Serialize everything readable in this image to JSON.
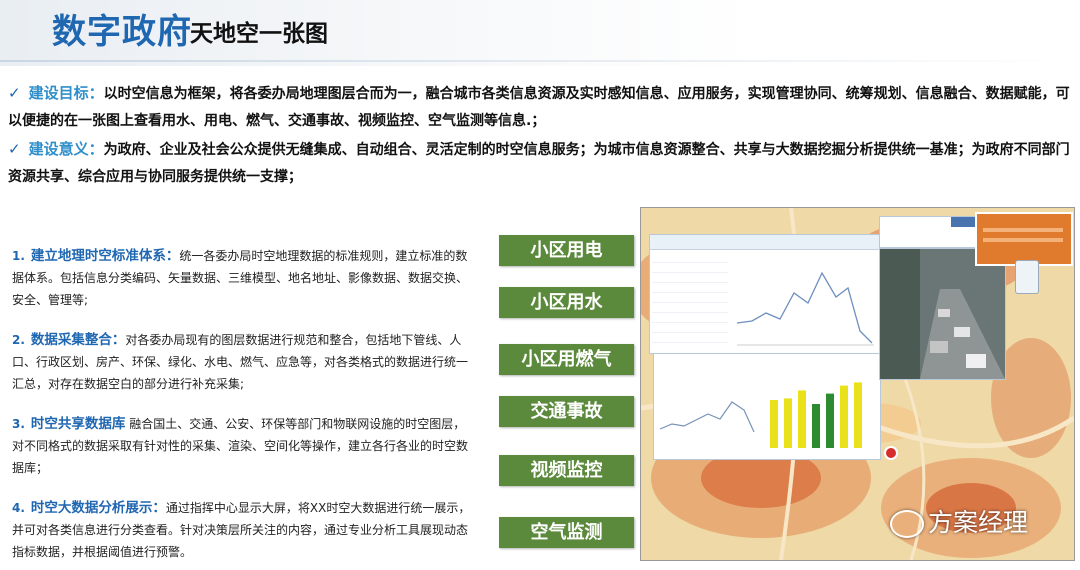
{
  "header": {
    "title_main": "数字政府",
    "title_sub": "天地空一张图"
  },
  "goals": [
    {
      "label": "建设目标：",
      "text": "以时空信息为框架，将各委办局地理图层合而为一，融合城市各类信息资源及实时感知信息、应用服务，实现管理协同、统筹规划、信息融合、数据赋能，可以便捷的在一张图上查看用水、用电、燃气、交通事故、视频监控、空气监测等信息.；"
    },
    {
      "label": "建设意义：",
      "text": "为政府、企业及社会公众提供无缝集成、自动组合、灵活定制的时空信息服务；为城市信息资源整合、共享与大数据挖掘分析提供统一基准；为政府不同部门资源共享、综合应用与协同服务提供统一支撑；"
    }
  ],
  "items": [
    {
      "num": "1.",
      "head": "建立地理时空标准体系：",
      "text": "统一各委办局时空地理数据的标准规则，建立标准的数据体系。包括信息分类编码、矢量数据、三维模型、地名地址、影像数据、数据交换、安全、管理等;"
    },
    {
      "num": "2.",
      "head": "数据采集整合：",
      "text": "对各委办局现有的图层数据进行规范和整合，包括地下管线、人口、行政区划、房产、环保、绿化、水电、燃气、应急等，对各类格式的数据进行统一汇总，对存在数据空白的部分进行补充采集;"
    },
    {
      "num": "3.",
      "head": "时空共享数据库",
      "text": "  融合国土、交通、公安、环保等部门和物联网设施的时空图层，对不同格式的数据采取有针对性的采集、渲染、空间化等操作，建立各行各业的时空数据库；"
    },
    {
      "num": "4.",
      "head": "时空大数据分析展示：",
      "text": "通过指挥中心显示大屏，将XX时空大数据进行统一展示，并可对各类信息进行分类查看。针对决策层所关注的内容，通过专业分析工具展现动态指标数据，并根据阈值进行预警。"
    }
  ],
  "tags": [
    "小区用电",
    "小区用水",
    "小区用燃气",
    "交通事故",
    "视频监控",
    "空气监测"
  ],
  "watermark": "方案经理",
  "colors": {
    "title_blue": "#1f67b1",
    "label_blue": "#2f8fcb",
    "tag_green": "#5c8a3c"
  },
  "chart_data": {
    "type": "bar",
    "values": [
      60,
      62,
      72,
      55,
      68,
      78,
      82
    ],
    "ylim": [
      0,
      100
    ]
  }
}
